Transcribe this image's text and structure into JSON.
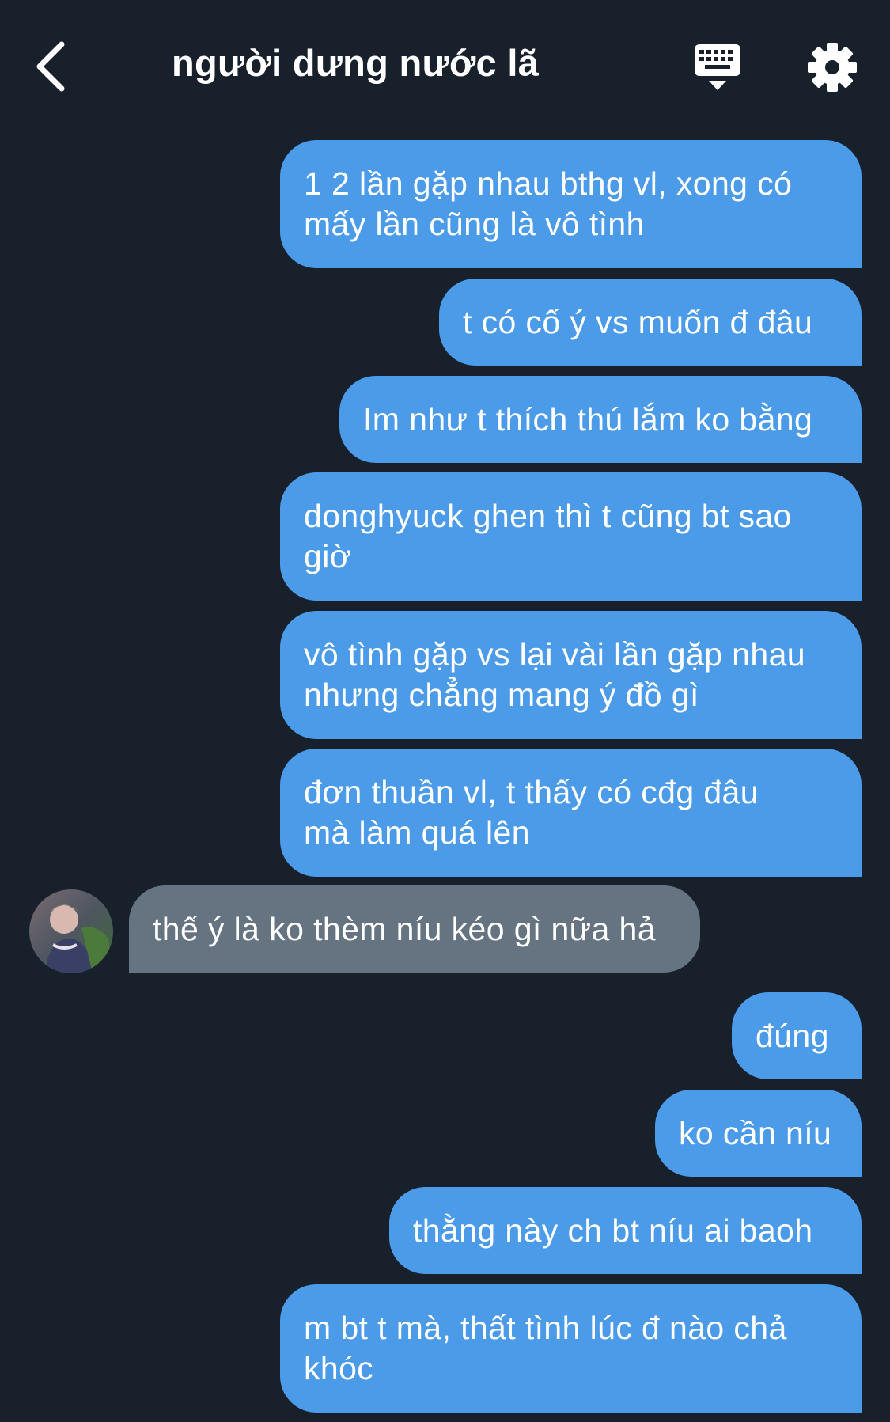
{
  "header": {
    "title": "người dưng nước lã",
    "back_icon": "chevron-left-icon",
    "keyboard_icon": "keyboard-icon",
    "settings_icon": "gear-icon"
  },
  "colors": {
    "background": "#18202c",
    "outgoing_bubble": "#4b9be9",
    "incoming_bubble": "#667482",
    "text": "#ffffff"
  },
  "messages": [
    {
      "sender": "me",
      "text": "1 2 lần gặp nhau bthg vl, xong có\nmấy lần cũng là vô tình"
    },
    {
      "sender": "me",
      "text": "t có cố ý vs muốn đ đâu"
    },
    {
      "sender": "me",
      "text": "Im như t thích thú lắm ko bằng"
    },
    {
      "sender": "me",
      "text": "donghyuck ghen thì t cũng bt sao\ngiờ"
    },
    {
      "sender": "me",
      "text": "vô tình gặp vs lại vài lần gặp nhau\nnhưng chẳng mang ý đồ gì"
    },
    {
      "sender": "me",
      "text": "đơn thuần vl, t thấy có cđg đâu\nmà làm quá lên"
    },
    {
      "sender": "them",
      "text": "thế ý là ko thèm níu kéo gì nữa hả"
    },
    {
      "sender": "me",
      "text": "đúng"
    },
    {
      "sender": "me",
      "text": "ko cần níu"
    },
    {
      "sender": "me",
      "text": "thằng này ch bt níu ai baoh"
    },
    {
      "sender": "me",
      "text": "m bt t mà, thất tình lúc đ nào chả\nkhóc"
    }
  ]
}
